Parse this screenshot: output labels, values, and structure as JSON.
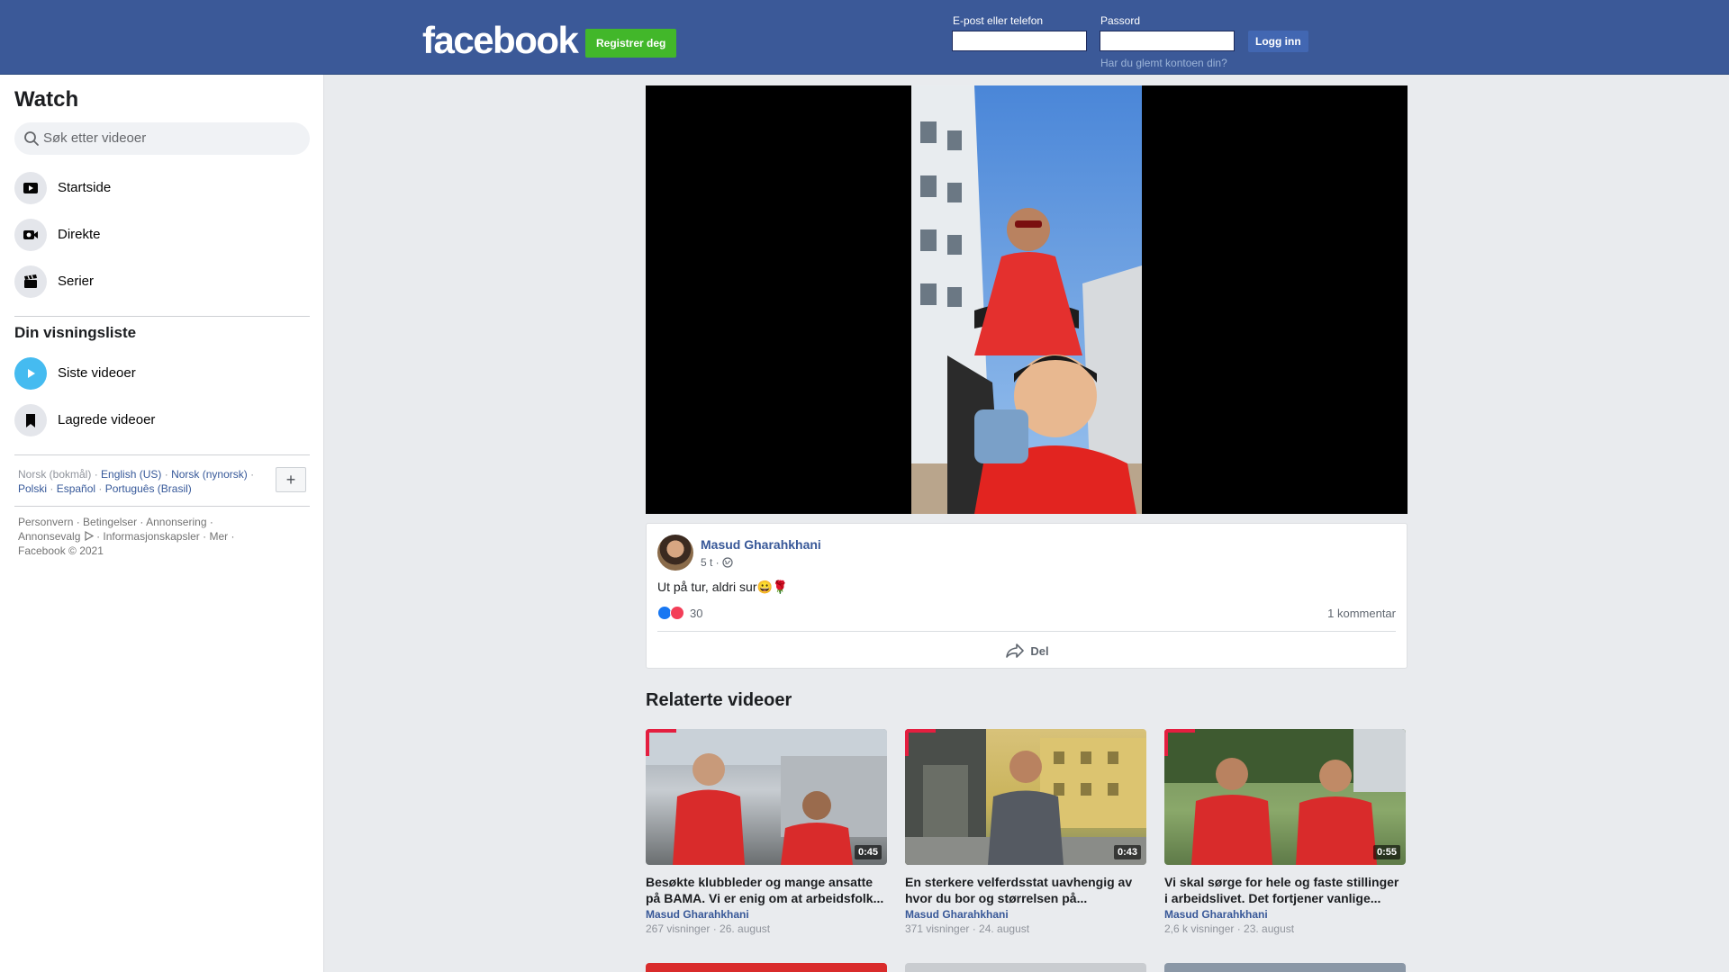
{
  "header": {
    "logo": "facebook",
    "register_label": "Registrer deg",
    "email_label": "E-post eller telefon",
    "password_label": "Passord",
    "login_label": "Logg inn",
    "forgot_label": "Har du glemt kontoen din?"
  },
  "sidebar": {
    "title": "Watch",
    "search_placeholder": "Søk etter videoer",
    "nav": [
      {
        "label": "Startside",
        "icon": "play-square-icon"
      },
      {
        "label": "Direkte",
        "icon": "live-camera-icon"
      },
      {
        "label": "Serier",
        "icon": "clapperboard-icon"
      }
    ],
    "watchlist_title": "Din visningsliste",
    "watchlist": [
      {
        "label": "Siste videoer",
        "icon": "play-circle-icon"
      },
      {
        "label": "Lagrede videoer",
        "icon": "bookmark-icon"
      }
    ],
    "languages": {
      "current": "Norsk (bokmål)",
      "others": [
        "English (US)",
        "Norsk (nynorsk)",
        "Polski",
        "Español",
        "Português (Brasil)"
      ],
      "add_label": "+"
    },
    "footer": {
      "links": [
        "Personvern",
        "Betingelser",
        "Annonsering",
        "Annonsevalg",
        "Informasjonskapsler",
        "Mer"
      ],
      "copyright": "Facebook © 2021"
    }
  },
  "post": {
    "author": "Masud Gharahkhani",
    "time": "5 t ·",
    "text": "Ut på tur, aldri sur😀🌹",
    "reaction_count": "30",
    "comments": "1 kommentar",
    "share_label": "Del"
  },
  "related": {
    "title": "Relaterte videoer",
    "items": [
      {
        "title": "Besøkte klubbleder og mange ansatte på BAMA. Vi er enig om at arbeidsfolk...",
        "author": "Masud Gharahkhani",
        "meta": "267 visninger · 26. august",
        "duration": "0:45"
      },
      {
        "title": "En sterkere velferdsstat uavhengig av hvor du bor og størrelsen på...",
        "author": "Masud Gharahkhani",
        "meta": "371 visninger · 24. august",
        "duration": "0:43"
      },
      {
        "title": "Vi skal sørge for hele og faste stillinger i arbeidslivet. Det fortjener vanlige...",
        "author": "Masud Gharahkhani",
        "meta": "2,6 k visninger · 23. august",
        "duration": "0:55"
      }
    ]
  },
  "colors": {
    "brand": "#3b5998",
    "register_green": "#42b72a",
    "link": "#385898"
  }
}
